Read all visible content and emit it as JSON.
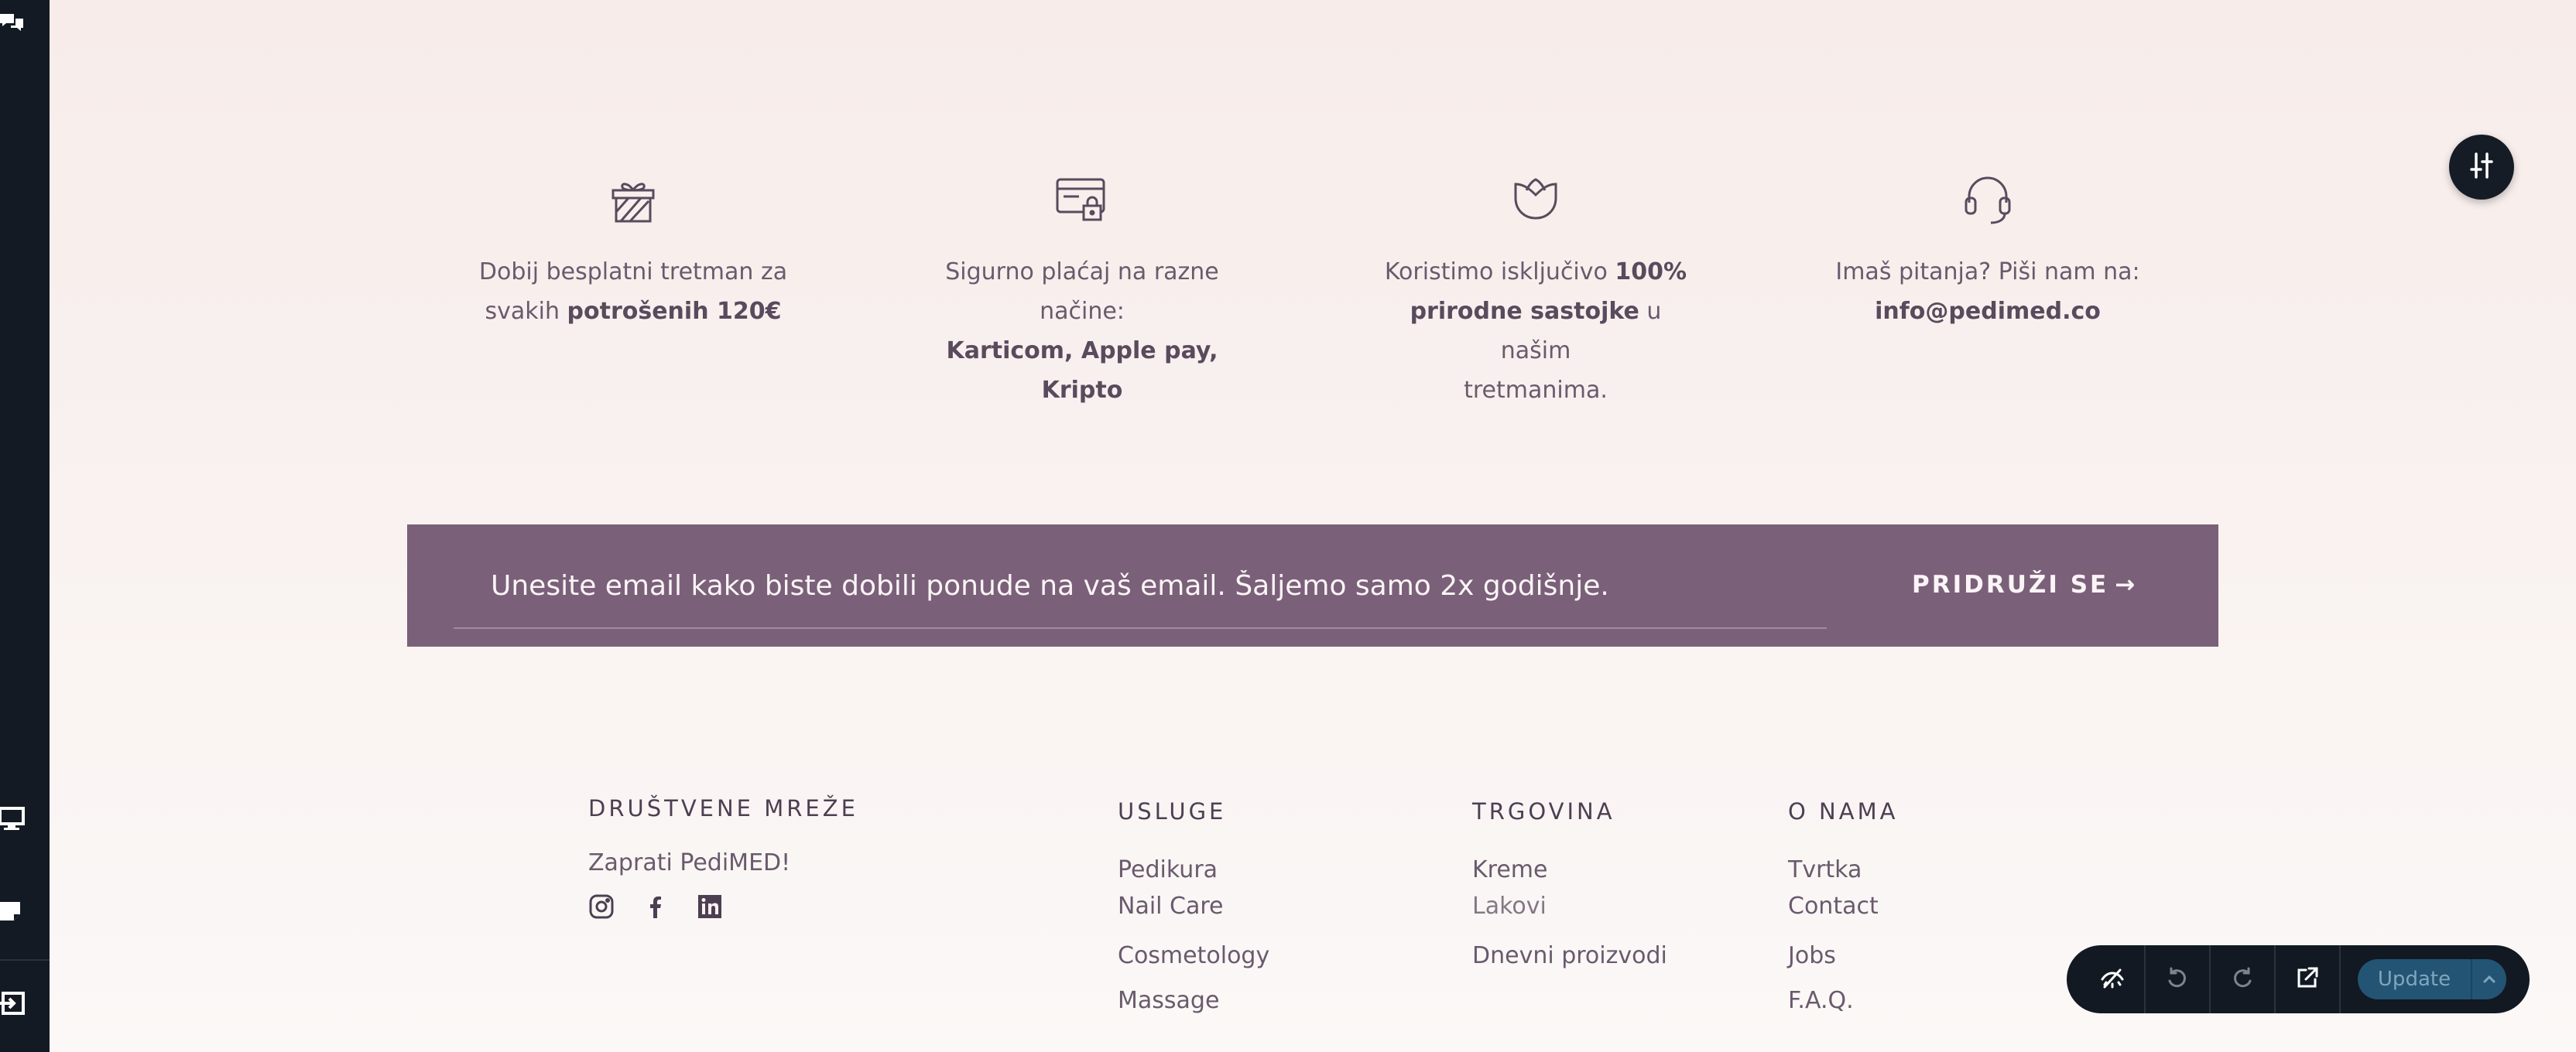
{
  "features": [
    {
      "icon": "gift-icon",
      "line1": "Dobij besplatni tretman za",
      "line2_pre": "svakih ",
      "line2_bold": "potrošenih 120€"
    },
    {
      "icon": "secure-card-icon",
      "line1": "Sigurno plaćaj na razne načine:",
      "line2_bold": "Karticom, Apple pay, Kripto"
    },
    {
      "icon": "tulip-icon",
      "line1_pre": "Koristimo isključivo ",
      "line1_bold": "100%",
      "line2_bold": "prirodne sastojke",
      "line2_post": " u našim",
      "line3": "tretmanima."
    },
    {
      "icon": "headset-icon",
      "line1": "Imaš pitanja? Piši nam na:",
      "line2_bold": "info@pedimed.co"
    }
  ],
  "newsletter": {
    "placeholder": "Unesite email kako biste dobili ponude na vaš email. Šaljemo samo 2x godišnje.",
    "button_label": "PRIDRUŽI SE",
    "button_arrow": "→",
    "background": "#7a6079"
  },
  "footer": {
    "social": {
      "heading": "DRUŠTVENE MREŽE",
      "tagline": "Zaprati PediMED!",
      "icons": [
        "instagram-icon",
        "facebook-icon",
        "linkedin-icon"
      ]
    },
    "services": {
      "heading": "USLUGE",
      "links": [
        "Pedikura",
        "Nail Care",
        "Cosmetology",
        "Massage"
      ]
    },
    "shop": {
      "heading": "TRGOVINA",
      "links": [
        "Kreme",
        "Lakovi",
        "Dnevni proizvodi"
      ]
    },
    "about": {
      "heading": "O NAMA",
      "links": [
        "Tvrtka",
        "Contact",
        "Jobs",
        "F.A.Q."
      ]
    }
  },
  "toolbar": {
    "buttons": [
      "hide-icon",
      "undo-icon",
      "redo-icon",
      "open-external-icon"
    ],
    "update_label": "Update",
    "update_color": "#235473"
  },
  "sidebar": {
    "icons": [
      "comments-icon",
      "desktop-icon",
      "note-icon",
      "exit-icon"
    ]
  },
  "colors": {
    "sidebar": "#141a23",
    "text": "#6a5a6d",
    "heading": "#4d3f52"
  }
}
